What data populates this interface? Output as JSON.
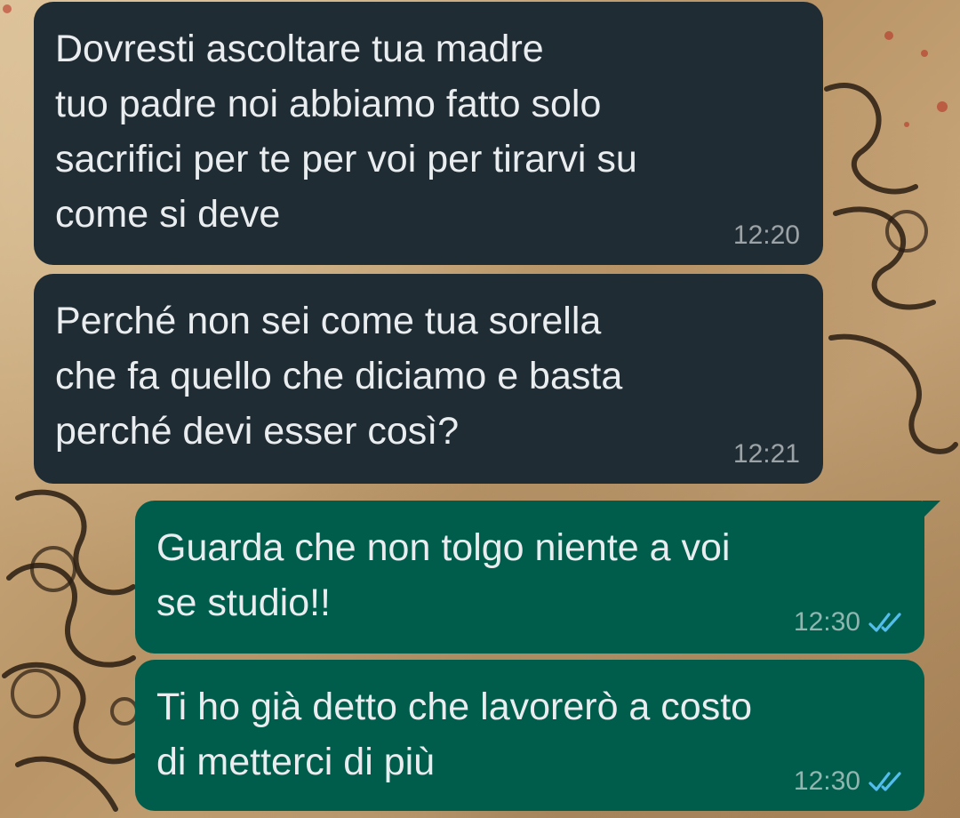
{
  "conversation": {
    "messages": [
      {
        "direction": "incoming",
        "text": "Dovresti ascoltare tua madre\ntuo padre noi abbiamo fatto solo\nsacrifici per te per voi per tirarvi su\ncome si deve",
        "time": "12:20"
      },
      {
        "direction": "incoming",
        "text": "Perché non sei come tua sorella\nche fa quello che diciamo e basta\nperché devi esser così?",
        "time": "12:21"
      },
      {
        "direction": "outgoing",
        "text": "Guarda che non tolgo niente a voi\nse studio!!",
        "time": "12:30",
        "status_icon": "double-check-read-icon"
      },
      {
        "direction": "outgoing",
        "text": "Ti ho già detto che lavorerò a costo\ndi metterci di più",
        "time": "12:30",
        "status_icon": "double-check-read-icon"
      }
    ]
  },
  "colors": {
    "incoming_bubble": "#202c33",
    "outgoing_bubble": "#005c4b",
    "message_text": "#e9edef",
    "read_ticks": "#53bdeb"
  }
}
